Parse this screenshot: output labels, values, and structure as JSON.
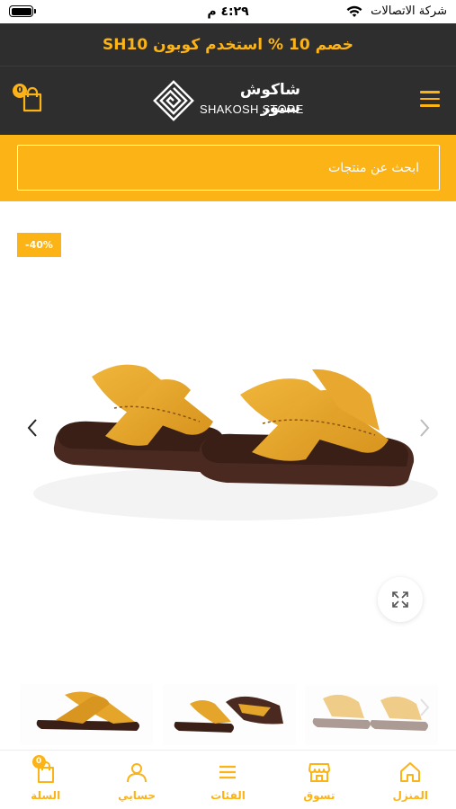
{
  "status_bar": {
    "time": "٤:٢٩ م",
    "carrier": "شركة الاتصالات"
  },
  "promo": {
    "text": "خصم 10 % استخدم كوبون   SH10"
  },
  "header": {
    "logo_arabic": "شاكوش ستور",
    "logo_english": "SHAKOSH STORE",
    "cart_count": "0"
  },
  "search": {
    "placeholder": "ابحث عن منتجات"
  },
  "product": {
    "discount_badge": "-40%",
    "thumbnails_count_visible": 3
  },
  "bottom_nav": {
    "items": [
      {
        "label": "المنزل",
        "icon": "home-icon"
      },
      {
        "label": "تسوق",
        "icon": "store-icon"
      },
      {
        "label": "الفئات",
        "icon": "menu-icon"
      },
      {
        "label": "حسابي",
        "icon": "user-icon"
      },
      {
        "label": "السلة",
        "icon": "cart-icon"
      }
    ],
    "cart_badge": "0"
  },
  "colors": {
    "accent": "#fbb316",
    "header_bg": "#2e2e2e",
    "sandal_strap": "#e5a42a",
    "sandal_sole": "#4a2a20"
  }
}
